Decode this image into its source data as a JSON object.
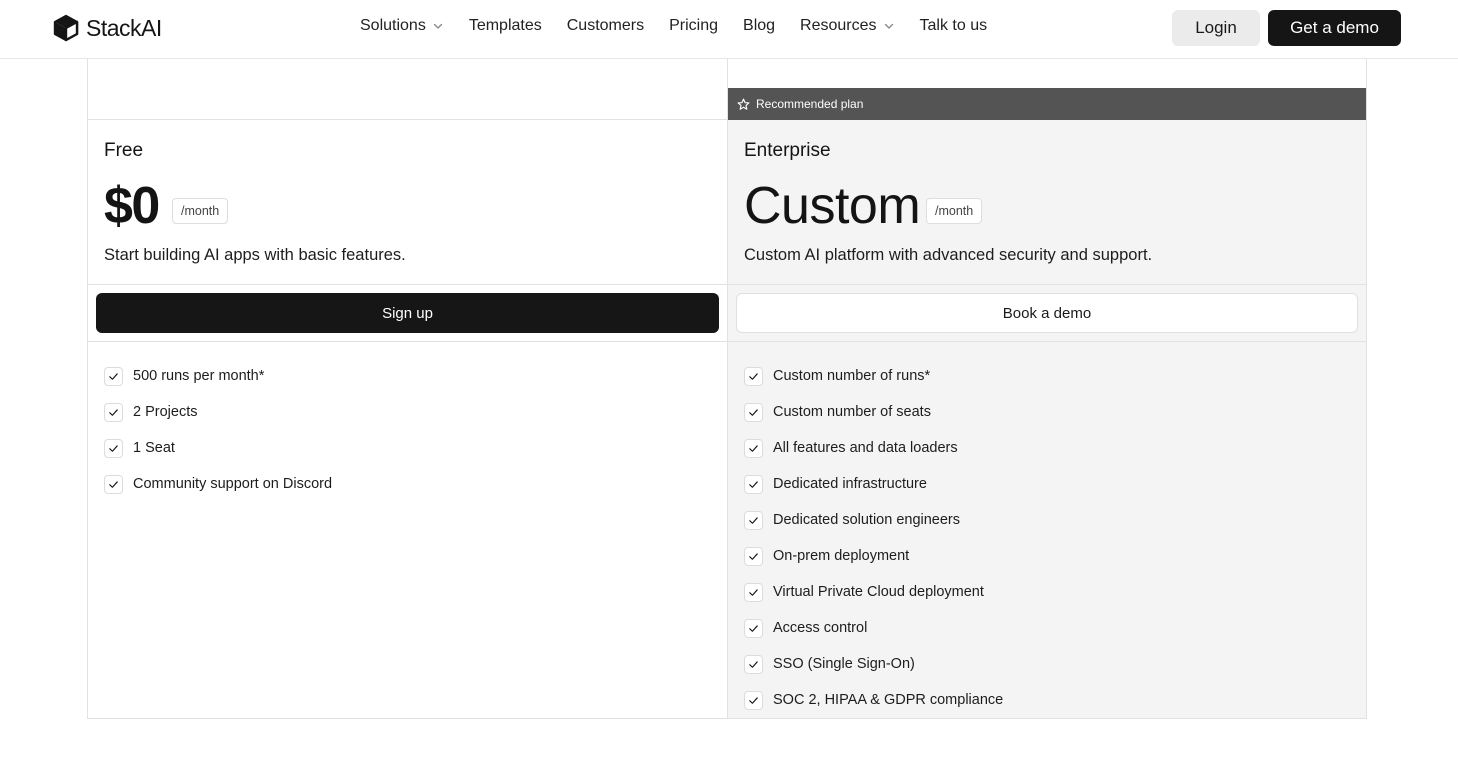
{
  "nav": {
    "brand": "StackAI",
    "links": [
      {
        "label": "Solutions",
        "has_dropdown": true
      },
      {
        "label": "Templates",
        "has_dropdown": false
      },
      {
        "label": "Customers",
        "has_dropdown": false
      },
      {
        "label": "Pricing",
        "has_dropdown": false
      },
      {
        "label": "Blog",
        "has_dropdown": false
      },
      {
        "label": "Resources",
        "has_dropdown": true
      },
      {
        "label": "Talk to us",
        "has_dropdown": false
      }
    ],
    "login_label": "Login",
    "demo_label": "Get a demo"
  },
  "plans": {
    "free": {
      "name": "Free",
      "price": "$0",
      "unit": "/month",
      "description": "Start building AI apps with basic features.",
      "cta": "Sign up",
      "features": [
        "500 runs per month*",
        "2 Projects",
        "1 Seat",
        "Community support on Discord"
      ]
    },
    "enterprise": {
      "badge": "Recommended plan",
      "name": "Enterprise",
      "price": "Custom",
      "unit": "/month",
      "description": "Custom AI platform with advanced security and support.",
      "cta": "Book a demo",
      "features": [
        "Custom number of runs*",
        "Custom number of seats",
        "All features and data loaders",
        "Dedicated infrastructure",
        "Dedicated solution engineers",
        "On-prem deployment",
        "Virtual Private Cloud deployment",
        "Access control",
        "SSO (Single Sign-On)",
        "SOC 2, HIPAA & GDPR compliance"
      ]
    }
  },
  "icons": {
    "logo": "stackai-logo-icon",
    "dropdown": "chevron-down-icon",
    "badge": "star-icon",
    "feature": "check-icon"
  },
  "colors": {
    "primary_button": "#161616",
    "recommended_banner": "#545454",
    "enterprise_background": "#f4f4f4"
  }
}
